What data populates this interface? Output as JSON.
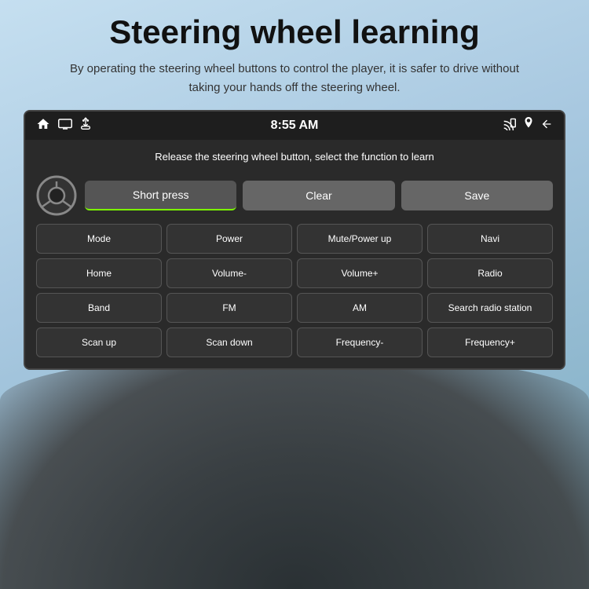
{
  "page": {
    "title": "Steering wheel learning",
    "subtitle": "By operating the steering wheel buttons to control the player, it is safer to drive without taking your hands off the steering wheel."
  },
  "status_bar": {
    "time": "8:55 AM",
    "icons_left": [
      "home-icon",
      "screen-icon",
      "usb-icon"
    ],
    "icons_right": [
      "cast-icon",
      "location-icon",
      "back-icon"
    ]
  },
  "instruction": "Release the steering wheel button, select the function to learn",
  "action_buttons": [
    {
      "id": "short-press",
      "label": "Short press",
      "active": true
    },
    {
      "id": "clear",
      "label": "Clear",
      "active": false
    },
    {
      "id": "save",
      "label": "Save",
      "active": false
    }
  ],
  "grid_buttons": [
    "Mode",
    "Power",
    "Mute/Power up",
    "Navi",
    "Home",
    "Volume-",
    "Volume+",
    "Radio",
    "Band",
    "FM",
    "AM",
    "Search radio station",
    "Scan up",
    "Scan down",
    "Frequency-",
    "Frequency+"
  ]
}
